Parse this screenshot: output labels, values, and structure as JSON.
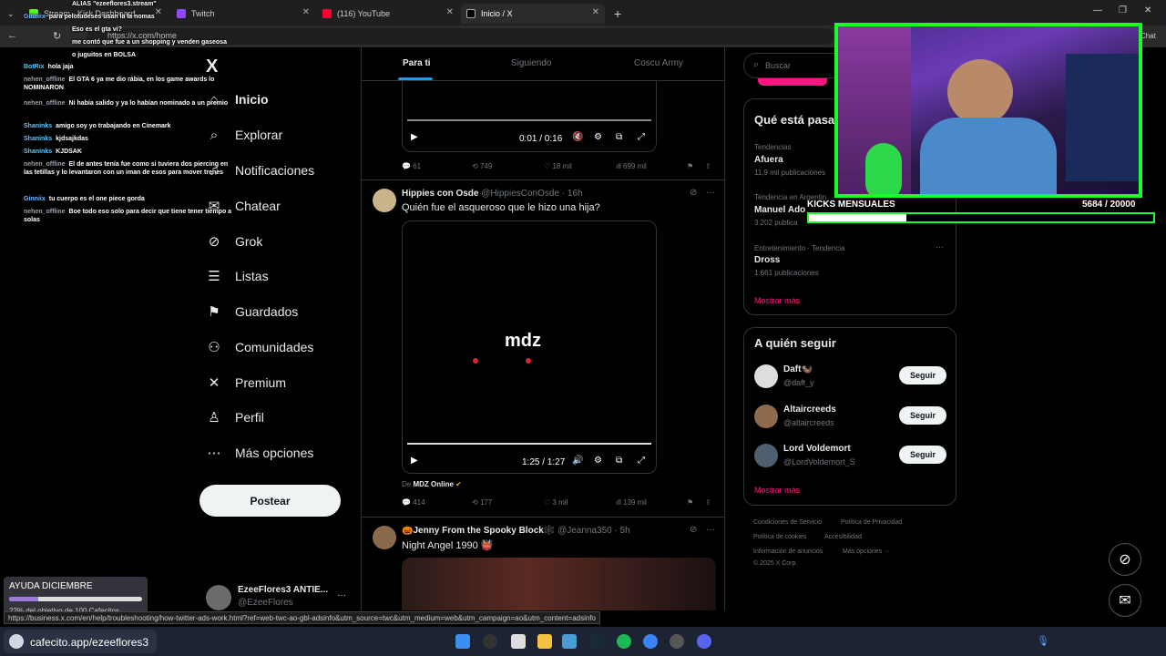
{
  "browser": {
    "tabs": [
      {
        "label": "Stream - Kick Dashboard"
      },
      {
        "label": "Twitch"
      },
      {
        "label": "(116) YouTube"
      },
      {
        "label": "Inicio / X"
      }
    ],
    "new_tab": "+",
    "url": "https://x.com/home",
    "chat_button": "Chat"
  },
  "nav": {
    "logo": "X",
    "items": [
      {
        "label": "Inicio",
        "icon": "home-icon",
        "glyph": "⌂"
      },
      {
        "label": "Explorar",
        "icon": "search-icon",
        "glyph": "⌕"
      },
      {
        "label": "Notificaciones",
        "icon": "bell-icon",
        "glyph": "♫"
      },
      {
        "label": "Chatear",
        "icon": "mail-icon",
        "glyph": "✉"
      },
      {
        "label": "Grok",
        "icon": "grok-icon",
        "glyph": "⊘"
      },
      {
        "label": "Listas",
        "icon": "list-icon",
        "glyph": "☰"
      },
      {
        "label": "Guardados",
        "icon": "bookmark-icon",
        "glyph": "⚑"
      },
      {
        "label": "Comunidades",
        "icon": "people-icon",
        "glyph": "⚇"
      },
      {
        "label": "Premium",
        "icon": "x-premium-icon",
        "glyph": "✕"
      },
      {
        "label": "Perfil",
        "icon": "person-icon",
        "glyph": "♙"
      },
      {
        "label": "Más opciones",
        "icon": "more-icon",
        "glyph": "⋯"
      }
    ],
    "post_label": "Postear",
    "account": {
      "name": "EzeeFlores3 ANTIE...",
      "handle": "@EzeeFlores",
      "more": "···"
    }
  },
  "feed": {
    "tabs": [
      "Para ti",
      "Siguiendo",
      "Coscu Army"
    ],
    "tweet1": {
      "time": "0:01 / 0:16",
      "replies": "61",
      "retweets": "749",
      "likes": "18 mil",
      "views": "699 mil"
    },
    "tweet2": {
      "name": "Hippies con Osde",
      "handle": "@HippiesConOsde",
      "time": "16h",
      "text": "Quién fue el asqueroso que le hizo una hija?",
      "video_brand": "mdz",
      "video_time": "1:25 / 1:27",
      "source_prefix": "De",
      "source": "MDZ Online",
      "replies": "414",
      "retweets": "177",
      "likes": "3 mil",
      "views": "139 mil"
    },
    "tweet3": {
      "name": "🎃Jenny From the Spooky Block🕸️",
      "handle": "@Jeanna350",
      "time": "5h",
      "text": "Night Angel  1990 👹"
    }
  },
  "right": {
    "search_placeholder": "Buscar",
    "trends_title": "Qué está pasa",
    "trends": [
      {
        "meta": "Tendencias",
        "name": "Afuera",
        "count": "11,9 mil publicaciones"
      },
      {
        "meta": "Tendencia en Argentin",
        "name": "Manuel Ado",
        "count": "3.202 publica"
      },
      {
        "meta": "Entretenimiento · Tendencia",
        "name": "Dross",
        "count": "1.661 publicaciones"
      }
    ],
    "show_more": "Mostrar más",
    "follow_title": "A quién seguir",
    "follow": [
      {
        "name": "Daft🦦",
        "handle": "@daft_y"
      },
      {
        "name": "Altaircreeds",
        "handle": "@altaircreeds"
      },
      {
        "name": "Lord Voldemort",
        "handle": "@LordVoldemort_S"
      }
    ],
    "follow_label": "Seguir",
    "footer": {
      "terms": "Condiciones de Servicio",
      "privacy": "Política de Privacidad",
      "cookies": "Política de cookies",
      "access": "Accesibilidad",
      "ads": "Información de anuncios",
      "more": "Más opciones ···",
      "copy": "© 2025 X Corp."
    }
  },
  "chat": [
    {
      "user": "",
      "text": "ALIAS \"ezeeflores3.stream\"",
      "color": "#ffffff"
    },
    {
      "user": "Ginniix",
      "text": "para pelotudeses usan la la nomas",
      "color": "#7ab8ff"
    },
    {
      "user": "",
      "text": "Eso es el gta vi?",
      "color": "#ffffff"
    },
    {
      "user": "",
      "text": "me contó que fue a un shopping y venden gaseosa",
      "color": "#ffffff"
    },
    {
      "user": "",
      "text": "o juguitos en BOLSA",
      "color": "#ffffff"
    },
    {
      "user": "BotRix",
      "text": "hola jaja",
      "color": "#5bc8ff"
    },
    {
      "user": "nehen_offline",
      "text": "El GTA 6 ya me dio rábia, en los game awards lo NOMINARON",
      "color": "#9aa3ad"
    },
    {
      "user": "nehen_offline",
      "text": "Ni había salido y ya lo habían nominado a un premio",
      "color": "#9aa3ad"
    },
    {
      "user": "Shaninks",
      "text": "amigo soy yo trabajando en Cinemark",
      "color": "#5bc8ff"
    },
    {
      "user": "Shaninks",
      "text": "kjdsajkdas",
      "color": "#5bc8ff"
    },
    {
      "user": "Shaninks",
      "text": "KJDSAK",
      "color": "#5bc8ff"
    },
    {
      "user": "nehen_offline",
      "text": "El de antes tenía fue como si tuviera dos piercing en las tetillas y lo levantaron con un iman de esos para mover trenes",
      "color": "#9aa3ad"
    },
    {
      "user": "Ginniix",
      "text": "tu cuerpo es el one piece gorda",
      "color": "#7ab8ff"
    },
    {
      "user": "nehen_offline",
      "text": "Boe todo eso solo para decir que tiene tener tiempo a solas",
      "color": "#9aa3ad"
    }
  ],
  "kicks": {
    "label": "KICKS MENSUALES",
    "value": "5684  / 20000",
    "progress": 0.2842
  },
  "ayuda": {
    "title": "AYUDA DICIEMBRE",
    "sub": "22% del objetivo de 100 Cafecitos",
    "progress": 0.22
  },
  "status_url": "https://business.x.com/en/help/troubleshooting/how-twitter-ads-work.html?ref=web-twc-ao-gbl-adsinfo&utm_source=twc&utm_medium=web&utm_campaign=ao&utm_content=adsinfo",
  "cafecito": "cafecito.app/ezeeflores3",
  "colors": {
    "accent": "#1d9bf0",
    "follow_link": "#f91880",
    "kick_green": "#1aff2a"
  }
}
